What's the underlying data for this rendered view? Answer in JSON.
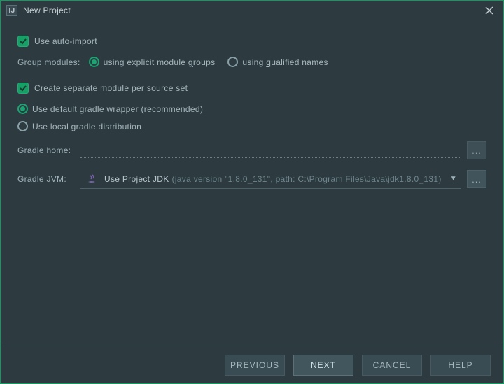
{
  "window": {
    "title": "New Project",
    "app_icon_letter": "IJ"
  },
  "options": {
    "auto_import_label": "Use auto-import",
    "group_modules_label": "Group modules:",
    "group_explicit_prefix": "using explicit module ",
    "group_explicit_underline": "g",
    "group_explicit_suffix": "roups",
    "group_qualified_prefix": "using ",
    "group_qualified_underline": "q",
    "group_qualified_suffix": "ualified names",
    "separate_module_label": "Create separate module per source set",
    "default_wrapper_label": "Use default gradle wrapper (recommended)",
    "local_distribution_label": "Use local gradle distribution"
  },
  "form": {
    "gradle_home_label": "Gradle home:",
    "gradle_home_value": "",
    "gradle_jvm_label": "Gradle JVM:",
    "jvm_main": "Use Project JDK",
    "jvm_sub": "(java version \"1.8.0_131\", path: C:\\Program Files\\Java\\jdk1.8.0_131)",
    "browse_dots": "..."
  },
  "footer": {
    "previous": "PREVIOUS",
    "next": "NEXT",
    "cancel": "CANCEL",
    "help": "HELP"
  }
}
